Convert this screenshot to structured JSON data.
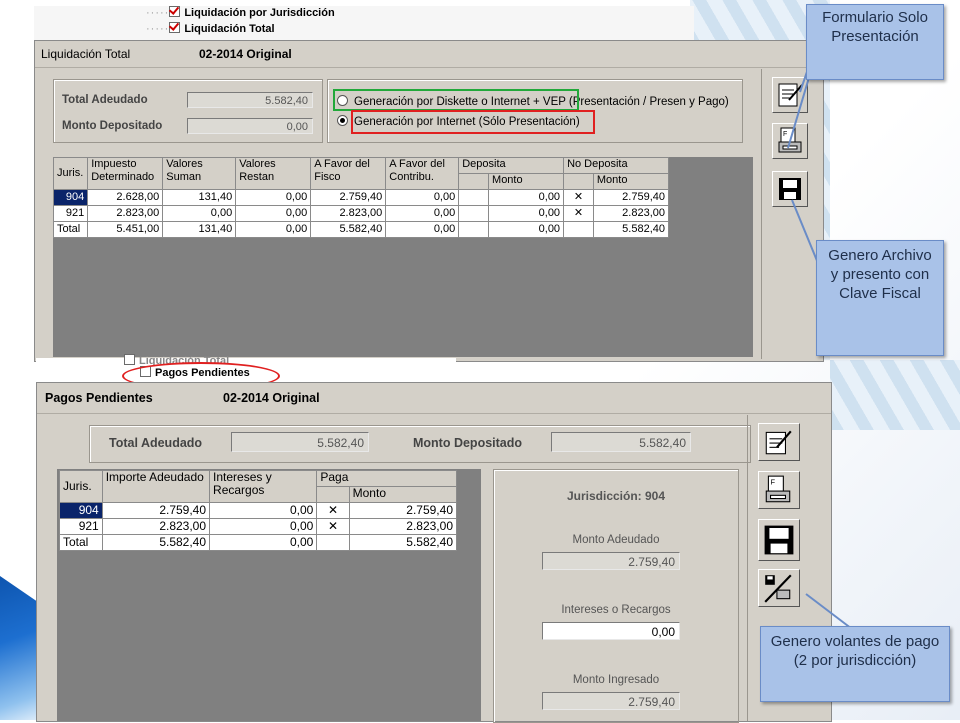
{
  "tree_top": {
    "item1": "Liquidación por Jurisdicción",
    "item2": "Liquidación Total"
  },
  "tree_bottom": {
    "partial": "Liquidación Total",
    "item": "Pagos Pendientes"
  },
  "top_window": {
    "title": "Liquidación Total",
    "period": "02-2014 Original",
    "total_adeudado_label": "Total Adeudado",
    "total_adeudado_value": "5.582,40",
    "monto_depositado_label": "Monto Depositado",
    "monto_depositado_value": "0,00",
    "option1": "Generación por Diskette o Internet + VEP",
    "option1_extra": "(Presentación / Presen y Pago)",
    "option2": "Generación por Internet (Sólo Presentación)",
    "headers": {
      "juris": "Juris.",
      "impuesto": "Impuesto Determinado",
      "valores_suman": "Valores Suman",
      "valores_restan": "Valores Restan",
      "favor_fisco": "A Favor del Fisco",
      "favor_contrib": "A Favor del Contribu.",
      "deposita": "Deposita",
      "no_deposita": "No Deposita",
      "monto": "Monto"
    },
    "rows": [
      {
        "juris": "904",
        "impuesto": "2.628,00",
        "suman": "131,40",
        "restan": "0,00",
        "fisco": "2.759,40",
        "contrib": "0,00",
        "dep_x": "",
        "dep_monto": "0,00",
        "nodep_x": "✕",
        "nodep_monto": "2.759,40"
      },
      {
        "juris": "921",
        "impuesto": "2.823,00",
        "suman": "0,00",
        "restan": "0,00",
        "fisco": "2.823,00",
        "contrib": "0,00",
        "dep_x": "",
        "dep_monto": "0,00",
        "nodep_x": "✕",
        "nodep_monto": "2.823,00"
      },
      {
        "juris": "Total",
        "impuesto": "5.451,00",
        "suman": "131,40",
        "restan": "0,00",
        "fisco": "5.582,40",
        "contrib": "0,00",
        "dep_x": "",
        "dep_monto": "0,00",
        "nodep_x": "",
        "nodep_monto": "5.582,40"
      }
    ]
  },
  "bottom_window": {
    "title": "Pagos Pendientes",
    "period": "02-2014 Original",
    "total_adeudado_label": "Total Adeudado",
    "total_adeudado_value": "5.582,40",
    "monto_depositado_label": "Monto Depositado",
    "monto_depositado_value": "5.582,40",
    "headers": {
      "juris": "Juris.",
      "importe": "Importe Adeudado",
      "intereses": "Intereses y Recargos",
      "paga": "Paga",
      "monto": "Monto"
    },
    "rows": [
      {
        "juris": "904",
        "importe": "2.759,40",
        "intereses": "0,00",
        "paga_x": "✕",
        "monto": "2.759,40"
      },
      {
        "juris": "921",
        "importe": "2.823,00",
        "intereses": "0,00",
        "paga_x": "✕",
        "monto": "2.823,00"
      },
      {
        "juris": "Total",
        "importe": "5.582,40",
        "intereses": "0,00",
        "paga_x": "",
        "monto": "5.582,40"
      }
    ],
    "panel": {
      "jurisdiccion": "Jurisdicción: 904",
      "monto_adeudado_label": "Monto Adeudado",
      "monto_adeudado_value": "2.759,40",
      "intereses_label": "Intereses o Recargos",
      "intereses_value": "0,00",
      "monto_ingresado_label": "Monto Ingresado",
      "monto_ingresado_value": "2.759,40"
    }
  },
  "callouts": {
    "formulario": "Formulario Solo Presentación",
    "genero_archivo": "Genero Archivo y presento con Clave Fiscal",
    "genero_volantes": "Genero volantes de pago (2 por jurisdicción)"
  },
  "colors": {
    "callout_bg": "#a9c2e8",
    "highlight_green": "#22a83a",
    "highlight_red": "#e02020",
    "selection": "#0a246a"
  }
}
